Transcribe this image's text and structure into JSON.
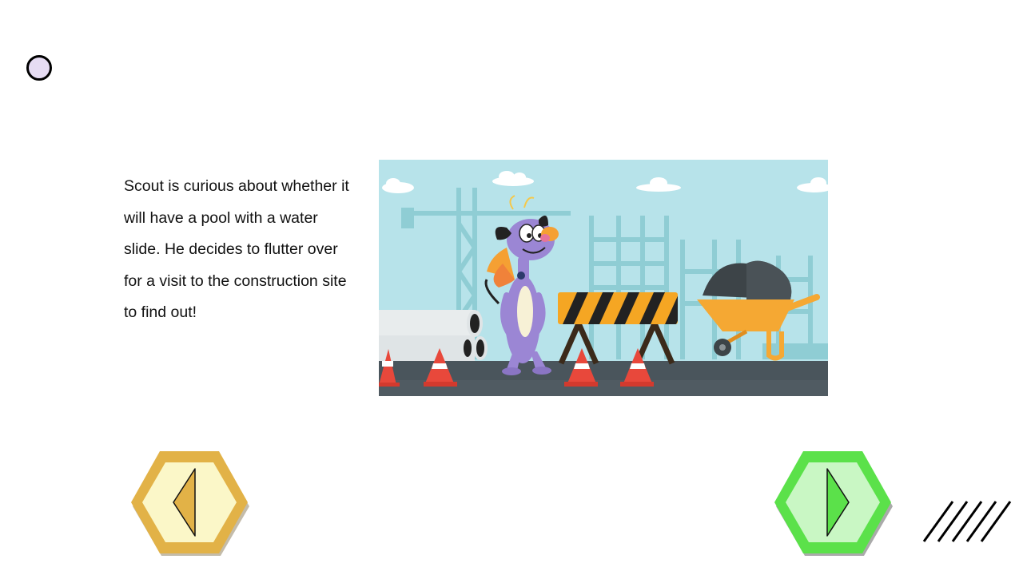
{
  "slide": {
    "story_text": "Scout is curious about whether it will have a pool with a water slide. He decides to flutter over for a visit to the construction site to find out!"
  },
  "scene": {
    "character": "Scout",
    "colors": {
      "sky": "#b7e3ea",
      "buildings": "#8fcdd4",
      "road": "#4a555c",
      "barrier_orange": "#f5a623",
      "wheelbarrow": "#f5a833",
      "cone": "#e8483b",
      "scout_body": "#9b86d4"
    }
  },
  "navigation": {
    "back": {
      "fill": "#e2b247",
      "inner": "#fbf7c8",
      "icon": "chevron-left-icon"
    },
    "next": {
      "fill": "#5be14a",
      "inner": "#c9f7c4",
      "icon": "chevron-right-icon"
    }
  }
}
